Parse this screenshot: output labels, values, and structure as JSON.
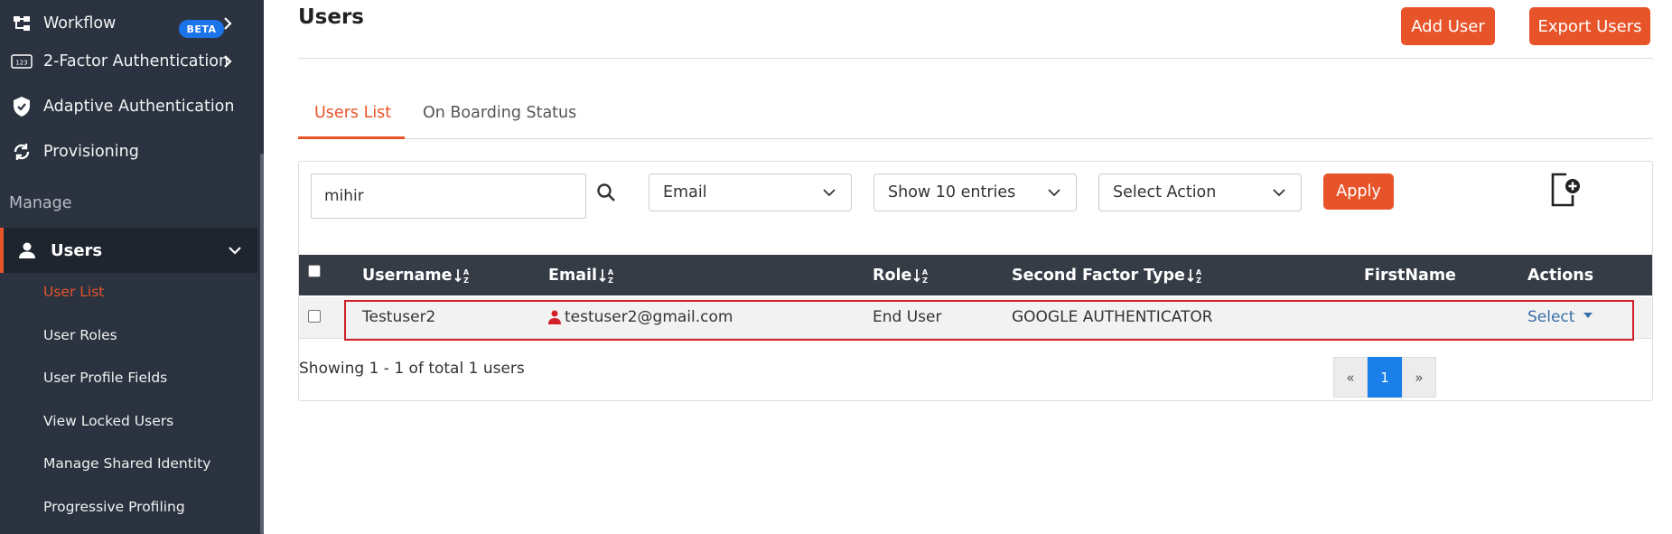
{
  "sidebar": {
    "items": [
      {
        "label": "Workflow",
        "badge": "BETA",
        "icon": "workflow-icon"
      },
      {
        "label": "2-Factor Authentication",
        "icon": "123-icon"
      },
      {
        "label": "Adaptive Authentication",
        "icon": "shield-icon"
      },
      {
        "label": "Provisioning",
        "icon": "sync-icon"
      }
    ],
    "section": "Manage",
    "active": {
      "label": "Users",
      "icon": "user-icon"
    },
    "subitems": [
      "User List",
      "User Roles",
      "User Profile Fields",
      "View Locked Users",
      "Manage Shared Identity",
      "Progressive Profiling"
    ],
    "active_subitem": "User List"
  },
  "header": {
    "title": "Users",
    "add_user": "Add User",
    "export_users": "Export Users"
  },
  "tabs": [
    "Users List",
    "On Boarding Status"
  ],
  "filters": {
    "search_value": "mihir",
    "field": "Email",
    "entries": "Show 10 entries",
    "action": "Select Action",
    "apply": "Apply"
  },
  "table": {
    "columns": [
      "Username",
      "Email",
      "Role",
      "Second Factor Type",
      "FirstName",
      "Actions"
    ],
    "rows": [
      {
        "username": "Testuser2",
        "email": "testuser2@gmail.com",
        "role": "End User",
        "second_factor": "GOOGLE AUTHENTICATOR",
        "firstname": "",
        "action": "Select"
      }
    ]
  },
  "footer": {
    "showing": "Showing 1 - 1 of total 1 users",
    "pager": [
      "«",
      "1",
      "»"
    ],
    "current_page": 1
  },
  "colors": {
    "accent": "#e8542a",
    "sidebar_bg": "#2b3340",
    "table_header": "#363c46",
    "highlight": "#d3222a",
    "link": "#3b6fa8",
    "page_active": "#1a7fe8"
  }
}
